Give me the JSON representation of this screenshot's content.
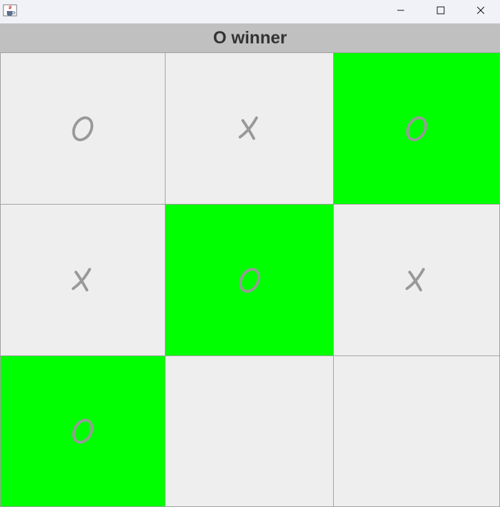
{
  "window": {
    "icon": "java-coffee-cup-icon",
    "controls": [
      "minimize-icon",
      "maximize-icon",
      "close-icon"
    ]
  },
  "status": {
    "text": "O winner"
  },
  "colors": {
    "win_cell": "#00ff00",
    "cell": "#eeeeee",
    "mark": "#999999",
    "status_bg": "#c0c0c0"
  },
  "board": {
    "cells": [
      {
        "mark": "O",
        "winning": false
      },
      {
        "mark": "X",
        "winning": false
      },
      {
        "mark": "O",
        "winning": true
      },
      {
        "mark": "X",
        "winning": false
      },
      {
        "mark": "O",
        "winning": true
      },
      {
        "mark": "X",
        "winning": false
      },
      {
        "mark": "O",
        "winning": true
      },
      {
        "mark": "",
        "winning": false
      },
      {
        "mark": "",
        "winning": false
      }
    ]
  }
}
